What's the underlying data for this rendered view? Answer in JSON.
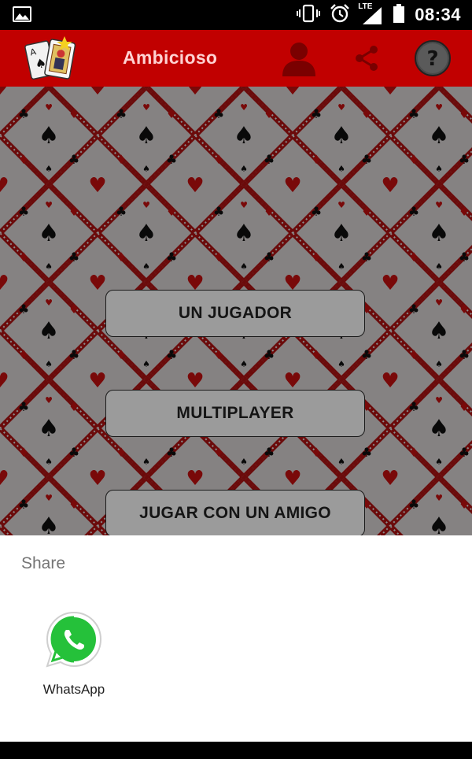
{
  "status_bar": {
    "time": "08:34",
    "network": "LTE",
    "icons": [
      "image-icon",
      "vibrate-icon",
      "alarm-icon",
      "signal-icon",
      "battery-icon"
    ]
  },
  "app_bar": {
    "title": "Ambicioso",
    "actions": [
      "profile-icon",
      "share-icon",
      "help-icon"
    ],
    "color": "#c10000"
  },
  "menu": {
    "buttons": [
      {
        "label": "UN JUGADOR"
      },
      {
        "label": "MULTIPLAYER"
      },
      {
        "label": "JUGAR CON UN AMIGO"
      }
    ]
  },
  "share_sheet": {
    "title": "Share",
    "targets": [
      {
        "label": "WhatsApp",
        "icon": "whatsapp-icon"
      }
    ]
  }
}
